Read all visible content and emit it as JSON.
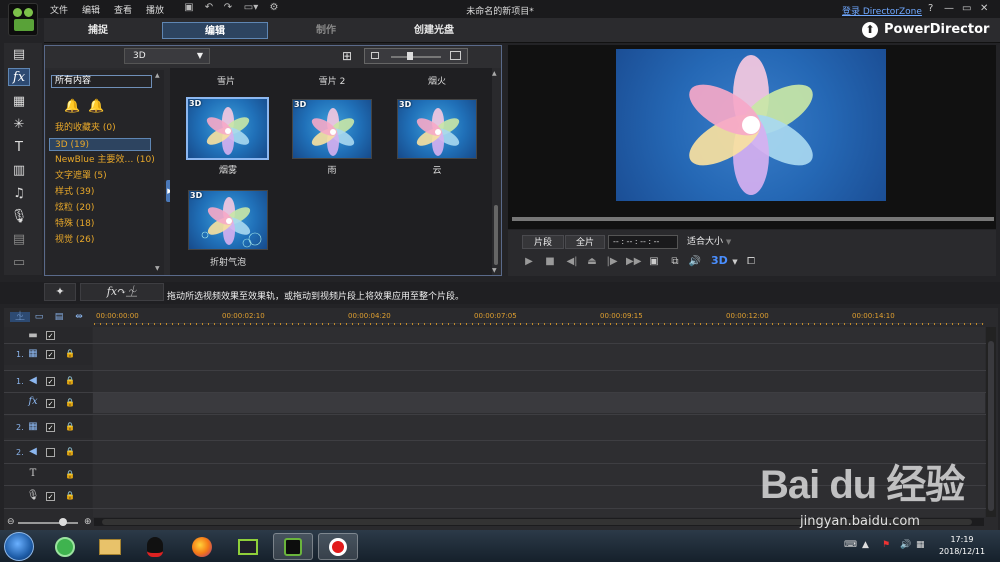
{
  "window": {
    "title": "未命名的新项目*",
    "login_link": "登录 DirectorZone",
    "brand": "PowerDirector"
  },
  "menu": [
    "文件",
    "编辑",
    "查看",
    "播放"
  ],
  "modes": [
    "捕捉",
    "编辑",
    "制作",
    "创建光盘"
  ],
  "library": {
    "type_select": "3D",
    "filter": "所有内容",
    "categories": [
      {
        "label": "我的收藏夹",
        "count": "(0)"
      },
      {
        "label": "3D",
        "count": "(19)"
      },
      {
        "label": "NewBlue 主要效…",
        "count": "(10)"
      },
      {
        "label": "文字遮罩",
        "count": "(5)"
      },
      {
        "label": "样式",
        "count": "(39)"
      },
      {
        "label": "炫粒",
        "count": "(20)"
      },
      {
        "label": "特殊",
        "count": "(18)"
      },
      {
        "label": "视觉",
        "count": "(26)"
      }
    ],
    "top_labels": [
      "雪片",
      "雪片 2",
      "烟火"
    ],
    "effects": [
      {
        "badge": "3D",
        "label": "烟雾",
        "selected": true
      },
      {
        "badge": "3D",
        "label": "雨",
        "selected": false
      },
      {
        "badge": "3D",
        "label": "云",
        "selected": false
      },
      {
        "badge": "3D",
        "label": "折射气泡",
        "selected": false
      }
    ]
  },
  "preview": {
    "clip_btn": "片段",
    "movie_btn": "全片",
    "timecode": "-- : -- : -- : --",
    "fit": "适合大小",
    "mode_3d": "3D"
  },
  "instruction": "拖动所选视频效果至效果轨，或拖动到视频片段上将效果应用至整个片段。",
  "timeline": {
    "ruler": [
      "00:00:00:00",
      "00:00:02:10",
      "00:00:04:20",
      "00:00:07:05",
      "00:00:09:15",
      "00:00:12:00",
      "00:00:14:10"
    ],
    "tracks": [
      {
        "num": "1.",
        "icon": "video-track-icon",
        "checked": true
      },
      {
        "num": "1.",
        "icon": "audio-track-icon",
        "checked": true
      },
      {
        "num": "",
        "icon": "fx-track-icon",
        "checked": true
      },
      {
        "num": "2.",
        "icon": "video-track-icon",
        "checked": true
      },
      {
        "num": "2.",
        "icon": "audio-track-icon",
        "checked": false
      },
      {
        "num": "",
        "icon": "title-track-icon",
        "checked": false
      },
      {
        "num": "",
        "icon": "voice-track-icon",
        "checked": true
      }
    ]
  },
  "taskbar": {
    "time": "17:19",
    "date": "2018/12/11"
  },
  "watermark": {
    "logo": "Bai du 经验",
    "url": "jingyan.baidu.com"
  }
}
